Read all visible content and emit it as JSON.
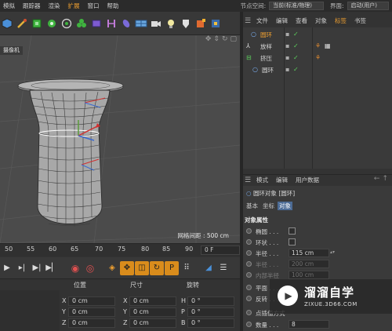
{
  "menubar": {
    "items": [
      "模拟",
      "跟踪器",
      "渲染",
      "扩展",
      "窗口",
      "帮助"
    ],
    "active_index": 3,
    "node_space_label": "节点空间:",
    "node_space_value": "当前(标准/物理)",
    "interface_label": "界面:",
    "interface_value": "启动(用户)"
  },
  "toolbar": {
    "icons": [
      "cube-icon",
      "brush-icon",
      "subdivision-icon",
      "array-icon",
      "spline-icon",
      "cloner-icon",
      "deformer-icon",
      "bend-icon",
      "floor-icon",
      "camera-icon",
      "light-icon",
      "sound-icon",
      "tag-icon",
      "python-icon"
    ]
  },
  "viewport": {
    "camera_tab": "摄像机",
    "grid_distance": "网格间距 : 500 cm"
  },
  "timeline": {
    "ticks": [
      "50",
      "55",
      "60",
      "65",
      "70",
      "75",
      "80",
      "85",
      "90"
    ],
    "current_frame": "0 F"
  },
  "coordinates": {
    "headers": {
      "position": "位置",
      "size": "尺寸",
      "rotation": "旋转"
    },
    "rows": [
      {
        "axis": "X",
        "pos": "0 cm",
        "size_axis": "X",
        "size": "0 cm",
        "rot_axis": "H",
        "rot": "0 °"
      },
      {
        "axis": "Y",
        "pos": "0 cm",
        "size_axis": "Y",
        "size": "0 cm",
        "rot_axis": "P",
        "rot": "0 °"
      },
      {
        "axis": "Z",
        "pos": "0 cm",
        "size_axis": "Z",
        "size": "0 cm",
        "rot_axis": "B",
        "rot": "0 °"
      }
    ]
  },
  "object_manager": {
    "menu": [
      "文件",
      "编辑",
      "查看",
      "对象",
      "标签",
      "书签"
    ],
    "active_index": 4,
    "objects": [
      {
        "name": "圆环",
        "indent": 1
      },
      {
        "name": "放样",
        "indent": 0
      },
      {
        "name": "挤压",
        "indent": 0
      },
      {
        "name": "圆环",
        "indent": 1
      }
    ]
  },
  "attribute_manager": {
    "menu": [
      "模式",
      "编辑",
      "用户数据"
    ],
    "object_title": "圆环对象 [圆环]",
    "tabs": [
      "基本",
      "坐标",
      "对象"
    ],
    "active_tab": 2,
    "section": "对象属性",
    "props": [
      {
        "label": "椭圆 . . .",
        "type": "checkbox",
        "dim": false
      },
      {
        "label": "环状 . . .",
        "type": "checkbox",
        "dim": false
      },
      {
        "label": "半径 . . .",
        "type": "value",
        "value": "115 cm",
        "dim": false
      },
      {
        "label": "半径 . . .",
        "type": "value",
        "value": "200 cm",
        "dim": true
      },
      {
        "label": "内部半径",
        "type": "value",
        "value": "100 cm",
        "dim": true
      },
      {
        "label": "平面 . . .",
        "type": "none",
        "dim": false
      },
      {
        "label": "反转 . . .",
        "type": "none",
        "dim": false
      },
      {
        "label": "点插值方式",
        "type": "none",
        "dim": false
      },
      {
        "label": "数量 . . .",
        "type": "value",
        "value": "8",
        "dim": false
      }
    ]
  },
  "watermark": {
    "title": "溜溜自学",
    "url": "ZIXUE.3D66.COM"
  },
  "colors": {
    "accent": "#f0a030",
    "tab_active": "#4c6b95",
    "panel": "#3a3a3a",
    "viewport": "#4b4b4b"
  }
}
